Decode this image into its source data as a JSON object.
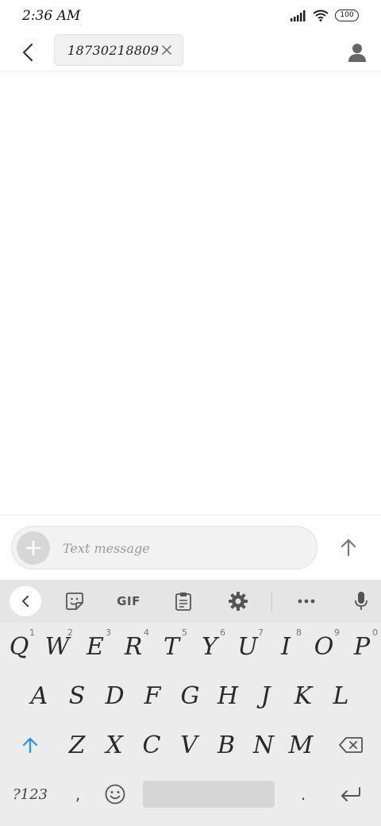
{
  "status_bar": {
    "time": "2:36 AM",
    "battery": "100"
  },
  "header": {
    "recipient": "18730218809"
  },
  "compose": {
    "placeholder": "Text message"
  },
  "keyboard": {
    "toolbar": {
      "gif_label": "GIF"
    },
    "row1": [
      {
        "char": "Q",
        "hint": "1"
      },
      {
        "char": "W",
        "hint": "2"
      },
      {
        "char": "E",
        "hint": "3"
      },
      {
        "char": "R",
        "hint": "4"
      },
      {
        "char": "T",
        "hint": "5"
      },
      {
        "char": "Y",
        "hint": "6"
      },
      {
        "char": "U",
        "hint": "7"
      },
      {
        "char": "I",
        "hint": "8"
      },
      {
        "char": "O",
        "hint": "9"
      },
      {
        "char": "P",
        "hint": "0"
      }
    ],
    "row2": [
      "A",
      "S",
      "D",
      "F",
      "G",
      "H",
      "J",
      "K",
      "L"
    ],
    "row3": [
      "Z",
      "X",
      "C",
      "V",
      "B",
      "N",
      "M"
    ],
    "symbols_label": "?123",
    "comma": ",",
    "period": "."
  },
  "colors": {
    "shift_accent": "#2196f3",
    "icon_gray": "#555555"
  },
  "icons": {
    "back": "back-arrow-icon",
    "chip_close": "close-icon",
    "contact": "person-icon",
    "attach": "plus-icon",
    "send": "arrow-up-icon",
    "kb_collapse": "chevron-left-icon",
    "sticker": "sticker-icon",
    "clipboard": "clipboard-icon",
    "settings": "gear-icon",
    "more": "more-icon",
    "mic": "microphone-icon",
    "shift": "shift-icon",
    "backspace": "backspace-icon",
    "emoji": "emoji-icon",
    "enter": "enter-icon"
  }
}
